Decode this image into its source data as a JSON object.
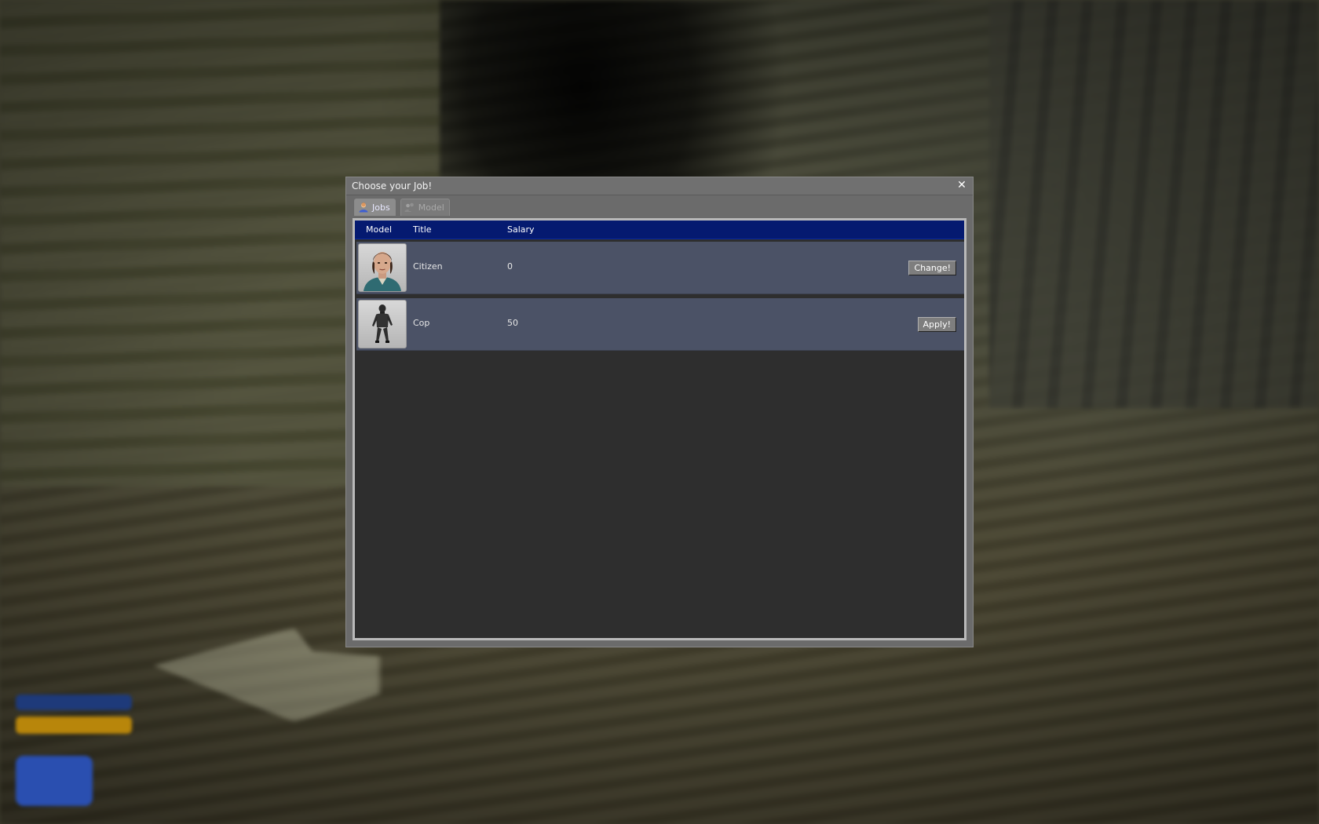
{
  "window": {
    "title": "Choose your Job!",
    "close_icon": "close-icon"
  },
  "tabs": [
    {
      "label": "Jobs",
      "icon": "user-icon",
      "active": true
    },
    {
      "label": "Model",
      "icon": "users-icon",
      "active": false
    }
  ],
  "columns": {
    "model": "Model",
    "title": "Title",
    "salary": "Salary"
  },
  "jobs": [
    {
      "title": "Citizen",
      "salary": "0",
      "button": "Change!",
      "model_icon": "citizen-portrait"
    },
    {
      "title": "Cop",
      "salary": "50",
      "button": "Apply!",
      "model_icon": "cop-figure"
    }
  ],
  "colors": {
    "header_bg": "#051a70",
    "row_bg": "#4b5266",
    "list_bg": "#2e2e2e",
    "window_bg": "#6b6b6b"
  }
}
